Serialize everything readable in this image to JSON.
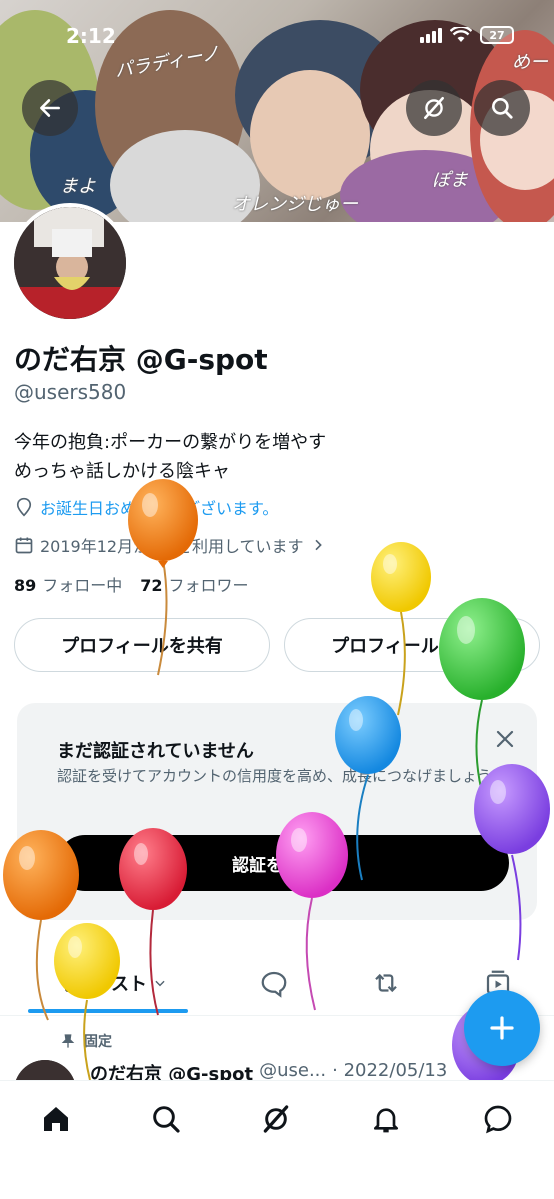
{
  "status_bar": {
    "time": "2:12",
    "battery": "27"
  },
  "banner": {
    "signatures": [
      "パラディーノ",
      "まよ",
      "オレンジじゅー",
      "ぽま",
      "めー"
    ]
  },
  "profile": {
    "display_name": "のだ右京 @G-spot",
    "handle": "@users580",
    "bio": [
      "今年の抱負:ポーカーの繋がりを増やす",
      "めっちゃ話しかける陰キャ"
    ],
    "birthday_text": "お誕生日おめでとうございます。",
    "joined_text": "2019年12月からXを利用しています",
    "following_count": "89",
    "following_label": "フォロー中",
    "followers_count": "72",
    "followers_label": "フォロワー"
  },
  "actions": {
    "share_label": "プロフィールを共有",
    "edit_label": "プロフィールを編集"
  },
  "verify": {
    "title": "まだ認証されていません",
    "description": "認証を受けてアカウントの信用度を高め、成長につなげましょう。",
    "cta": "認証を受ける"
  },
  "tabs": {
    "posts_label": "ポスト"
  },
  "pinned_post": {
    "pinned_label": "固定",
    "author_name": "のだ右京 @G-spot",
    "author_handle": "@use...",
    "date": "· 2022/05/13"
  },
  "colors": {
    "accent": "#1d9bf0",
    "text": "#0f1419",
    "muted": "#536471"
  },
  "icons": [
    "back-arrow-icon",
    "grok-icon",
    "search-icon",
    "location-icon",
    "calendar-icon",
    "chevron-right-icon",
    "close-icon",
    "posts-icon",
    "reply-icon",
    "repost-icon",
    "media-icon",
    "pin-icon",
    "plus-icon",
    "home-icon",
    "nav-search-icon",
    "nav-grok-icon",
    "bell-icon",
    "messages-icon"
  ]
}
